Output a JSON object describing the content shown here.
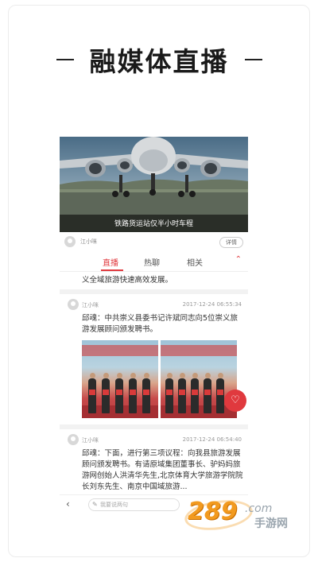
{
  "headline": {
    "title": "融媒体直播"
  },
  "video": {
    "caption": "铁路货运站仅半小时车程"
  },
  "live_author": {
    "name": "江小咪",
    "detail_label": "详情"
  },
  "tabs": [
    {
      "label": "直播",
      "active": true
    },
    {
      "label": "热聊",
      "active": false
    },
    {
      "label": "相关",
      "active": false
    }
  ],
  "tabs_collapse_icon": "chevron-up-icon",
  "feed": {
    "prev_text": "义全域旅游快速高效发展。",
    "posts": [
      {
        "author": "江小咪",
        "time": "2017-12-24 06:55:34",
        "text": "邱魂：中共崇义县委书记许斌同志向5位崇义旅游发展顾问颁发聘书。"
      },
      {
        "author": "江小咪",
        "time": "2017-12-24 06:54:40",
        "text": "邱魂：下面，进行第三项议程：向我县旅游发展顾问颁发聘书。有请原域集团董事长、驴妈妈旅游网创始人洪清华先生,北京体育大学旅游学院院长刘东先生、南京中国域旅游..."
      }
    ]
  },
  "bottom_bar": {
    "comment_placeholder": "我要说两句",
    "back_icon": "back-arrow-icon",
    "pen_icon": "pen-icon"
  },
  "heart_icon": "heart-icon",
  "watermark": {
    "number": "289",
    "suffix": ".com",
    "brand": "手游网"
  },
  "colors": {
    "accent": "#e0393e",
    "watermark_orange": "#f29a1f"
  }
}
